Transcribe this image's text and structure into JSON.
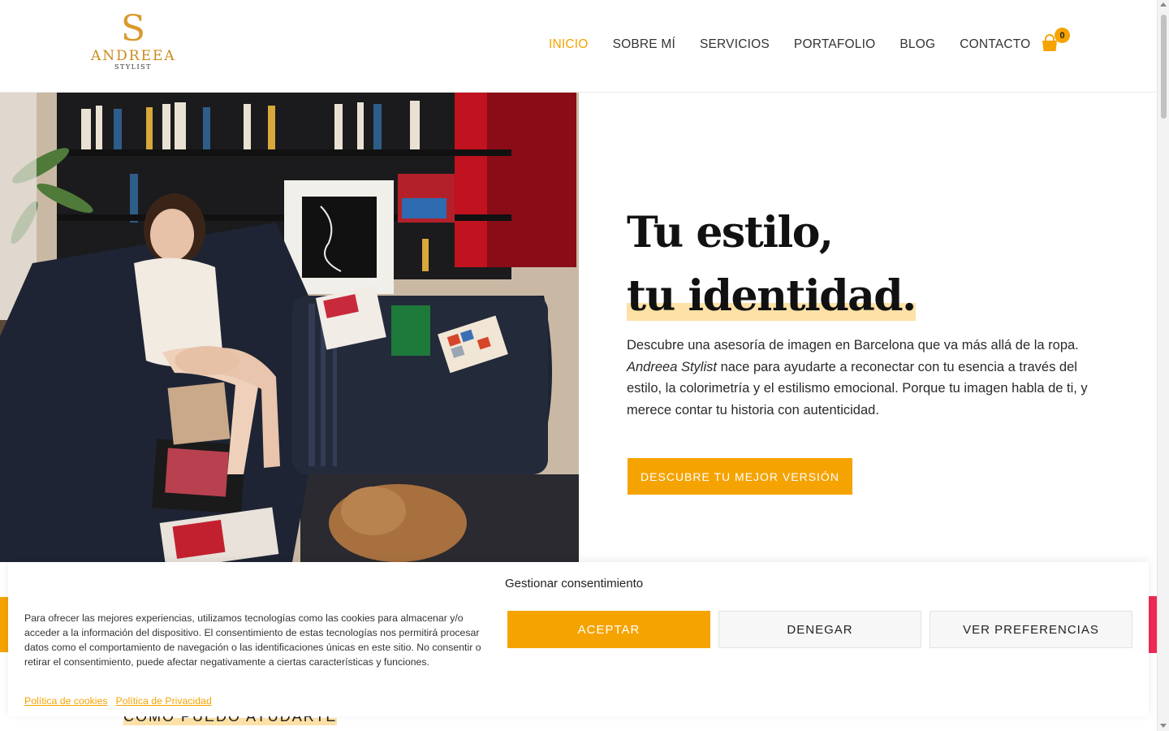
{
  "header": {
    "logo": {
      "mark": "S",
      "name": "ANDREEA",
      "tagline": "STYLIST"
    },
    "nav": [
      {
        "label": "INICIO",
        "active": true
      },
      {
        "label": "SOBRE MÍ",
        "active": false
      },
      {
        "label": "SERVICIOS",
        "active": false
      },
      {
        "label": "PORTAFOLIO",
        "active": false
      },
      {
        "label": "BLOG",
        "active": false
      },
      {
        "label": "CONTACTO",
        "active": false
      }
    ],
    "cart": {
      "icon": "shopping-bag-icon",
      "count": "0"
    }
  },
  "hero": {
    "image": "woman-sitting-on-sofa-photo",
    "title_line1": "Tu estilo,",
    "title_line2": "tu identidad.",
    "description_em": "Andreea Stylist",
    "description_part1": "Descubre una asesoría de imagen en Barcelona que va más allá de la ropa.",
    "description_part2": "nace para ayudarte a reconectar con tu esencia a través del estilo, la colorimetría y el estilismo emocional. Porque tu imagen habla de ti, y merece contar tu historia con autenticidad.",
    "cta": "DESCUBRE TU MEJOR VERSIÓN"
  },
  "next_section": {
    "heading": "CÓMO PUEDO AYUDARTE"
  },
  "consent": {
    "title": "Gestionar consentimiento",
    "text": "Para ofrecer las mejores experiencias, utilizamos tecnologías como las cookies para almacenar y/o acceder a la información del dispositivo. El consentimiento de estas tecnologías nos permitirá procesar datos como el comportamiento de navegación o las identificaciones únicas en este sitio. No consentir o retirar el consentimiento, puede afectar negativamente a ciertas características y funciones.",
    "accept": "ACEPTAR",
    "deny": "DENEGAR",
    "preferences": "VER PREFERENCIAS",
    "links": [
      "Política de cookies",
      "Política de Privacidad"
    ]
  },
  "colors": {
    "accent": "#f5a300",
    "highlight": "#fde1a6",
    "secondary": "#ef2b55"
  }
}
